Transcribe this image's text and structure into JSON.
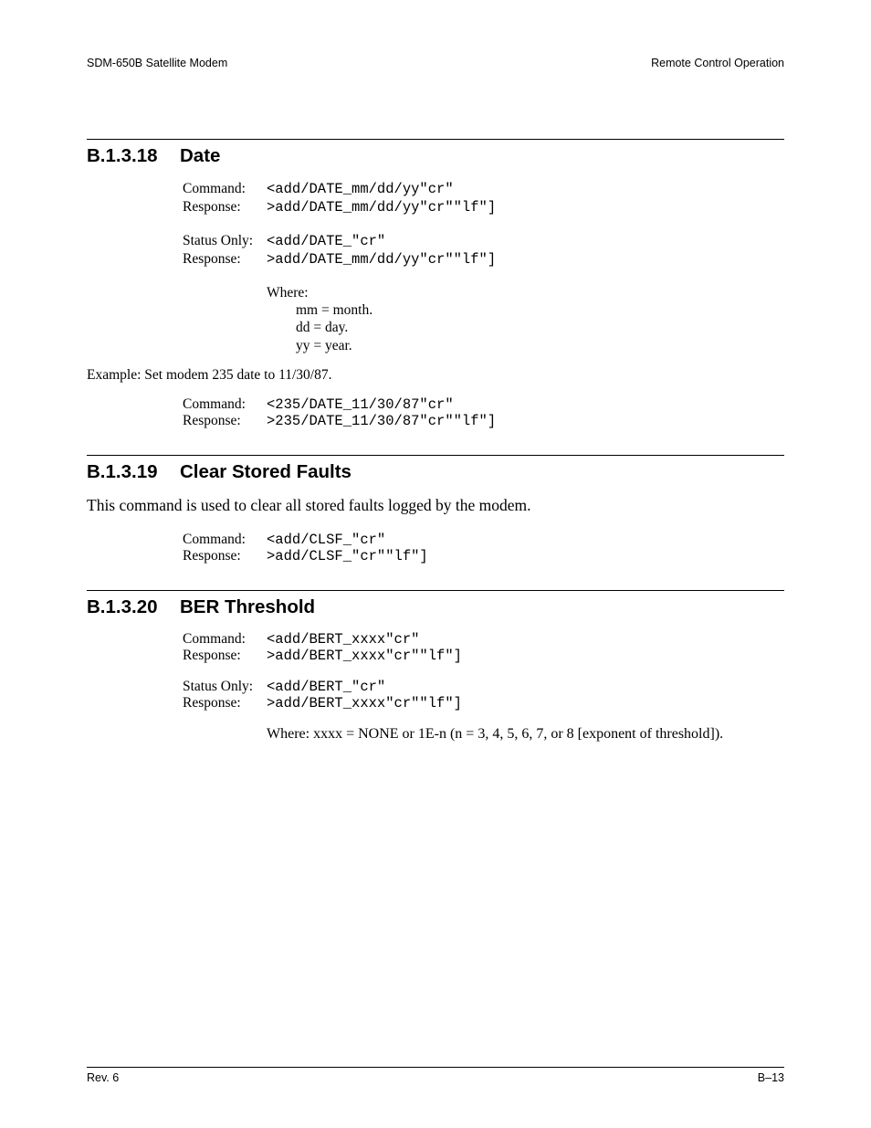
{
  "header": {
    "left": "SDM-650B Satellite Modem",
    "right": "Remote Control Operation"
  },
  "sections": {
    "date": {
      "number": "B.1.3.18",
      "title": "Date",
      "labels": {
        "command": "Command:",
        "response": "Response:",
        "status_only": "Status Only:"
      },
      "cmd1": "<add/DATE_mm/dd/yy\"cr\"",
      "resp1": ">add/DATE_mm/dd/yy\"cr\"\"lf\"]",
      "status_cmd": "<add/DATE_\"cr\"",
      "status_resp": ">add/DATE_mm/dd/yy\"cr\"\"lf\"]",
      "where_label": "Where:",
      "where_mm": "mm = month.",
      "where_dd": "dd = day.",
      "where_yy": "yy = year.",
      "example": "Example: Set modem 235 date to 11/30/87.",
      "ex_cmd": "<235/DATE_11/30/87\"cr\"",
      "ex_resp": ">235/DATE_11/30/87\"cr\"\"lf\"]"
    },
    "clsf": {
      "number": "B.1.3.19",
      "title": "Clear Stored Faults",
      "intro": "This command is used to clear all stored faults logged by the modem.",
      "labels": {
        "command": "Command:",
        "response": "Response:"
      },
      "cmd": "<add/CLSF_\"cr\"",
      "resp": ">add/CLSF_\"cr\"\"lf\"]"
    },
    "bert": {
      "number": "B.1.3.20",
      "title": "BER Threshold",
      "labels": {
        "command": "Command:",
        "response": "Response:",
        "status_only": "Status Only:"
      },
      "cmd1": "<add/BERT_xxxx\"cr\"",
      "resp1": ">add/BERT_xxxx\"cr\"\"lf\"]",
      "status_cmd": "<add/BERT_\"cr\"",
      "status_resp": ">add/BERT_xxxx\"cr\"\"lf\"]",
      "where": "Where: xxxx = NONE or 1E-n (n = 3, 4, 5, 6, 7, or 8 [exponent of threshold])."
    }
  },
  "footer": {
    "left": "Rev. 6",
    "right": "B–13"
  }
}
